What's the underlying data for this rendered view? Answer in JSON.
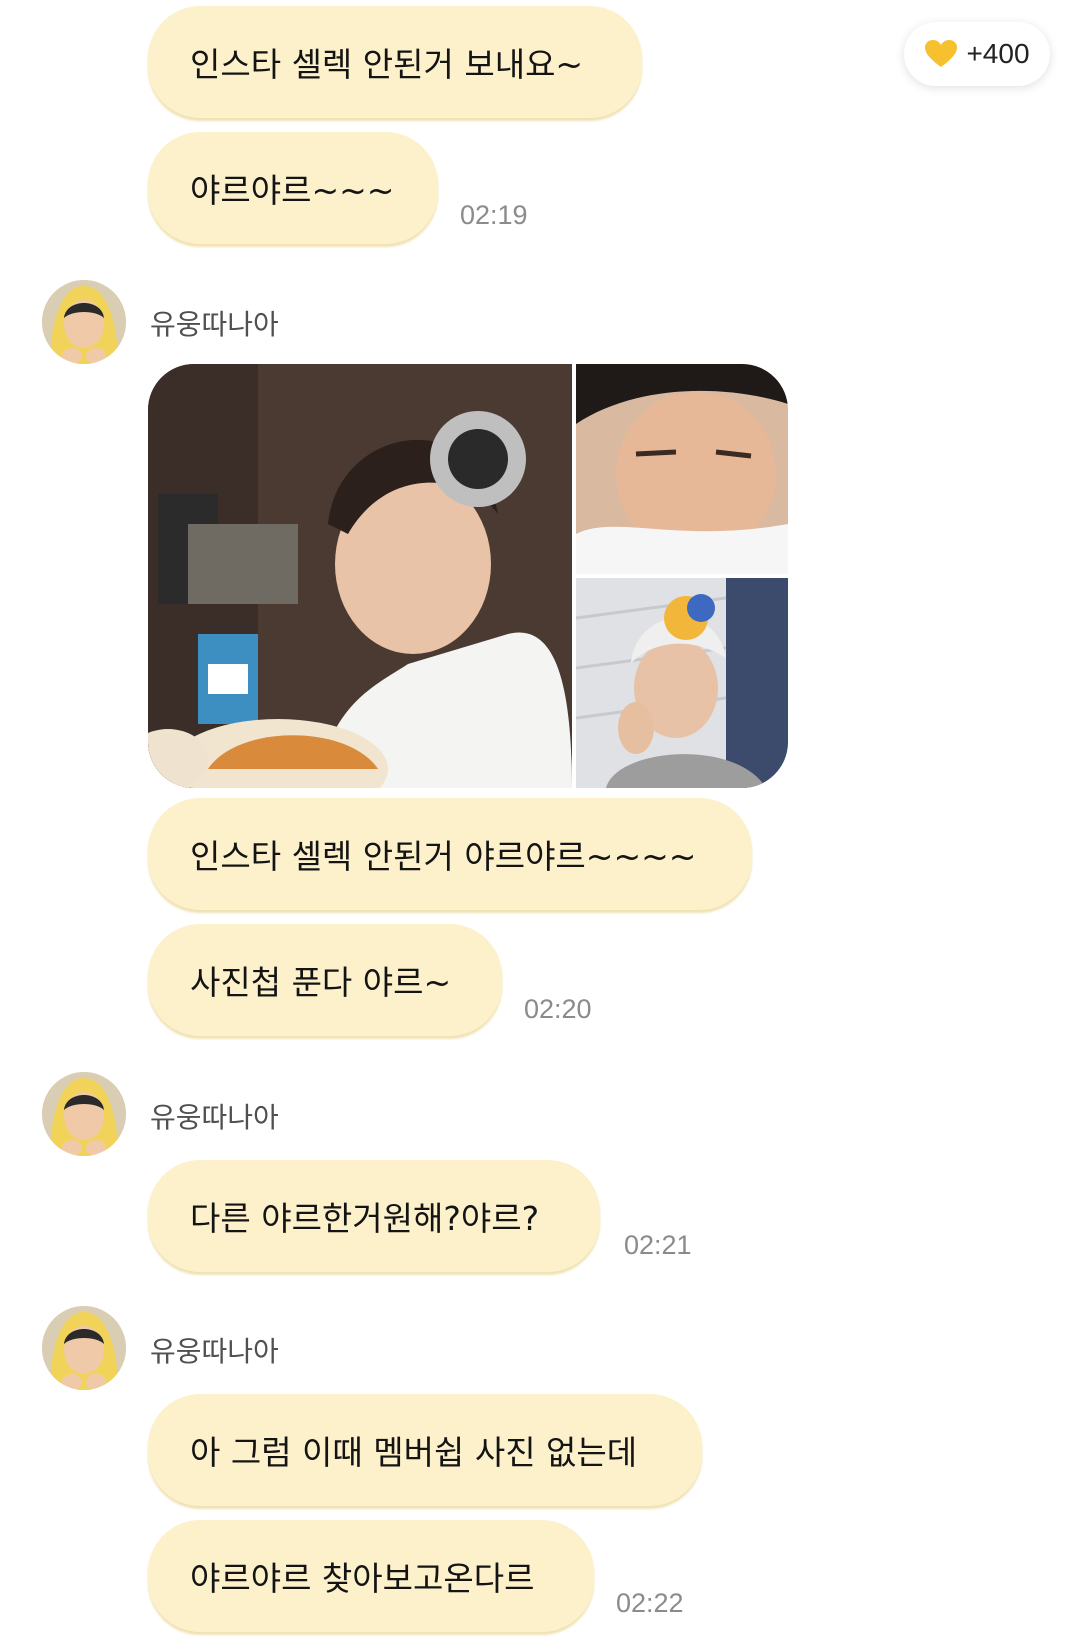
{
  "badge": {
    "icon": "heart-icon",
    "text": "+400",
    "icon_color": "#f7c02f"
  },
  "colors": {
    "bubble": "#fdf1cc",
    "timestamp": "#8b8b8b"
  },
  "messages": [
    {
      "text": "인스타 셀렉 안된거 보내요~"
    },
    {
      "text": "야르야르~~~",
      "time": "02:19"
    },
    {
      "sender": "유웅따나아"
    },
    {
      "text": "인스타 셀렉 안된거 야르야르~~~~"
    },
    {
      "text": "사진첩 푼다 야르~",
      "time": "02:20"
    },
    {
      "sender": "유웅따나아"
    },
    {
      "text": "다른 야르한거원해?야르?",
      "time": "02:21"
    },
    {
      "sender": "유웅따나아"
    },
    {
      "text": "아 그럼 이때 멤버쉽 사진 없는데"
    },
    {
      "text": "야르야르 찾아보고온다르",
      "time": "02:22"
    }
  ]
}
